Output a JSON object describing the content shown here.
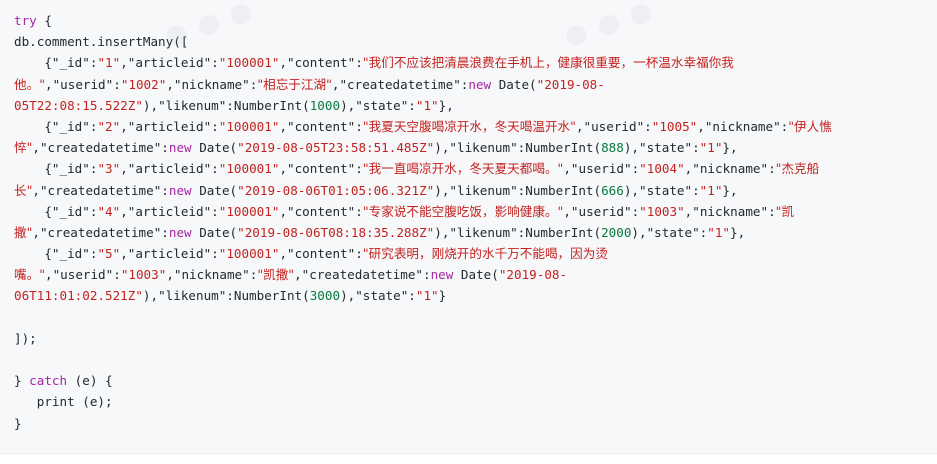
{
  "code_lines": [
    [
      {
        "t": "try",
        "c": "kw"
      },
      {
        "t": " {",
        "c": ""
      }
    ],
    [
      {
        "t": "db.comment.insertMany([",
        "c": ""
      }
    ],
    [
      {
        "t": "    {",
        "c": ""
      },
      {
        "t": "\"_id\"",
        "c": ""
      },
      {
        "t": ":",
        "c": ""
      },
      {
        "t": "\"1\"",
        "c": "str"
      },
      {
        "t": ",\"articleid\":",
        "c": ""
      },
      {
        "t": "\"100001\"",
        "c": "str"
      },
      {
        "t": ",\"content\":",
        "c": ""
      },
      {
        "t": "\"我们不应该把清晨浪费在手机上，健康很重要，一杯温水幸福你我",
        "c": "str cjk"
      }
    ],
    [
      {
        "t": "他。\"",
        "c": "str cjk"
      },
      {
        "t": ",\"userid\":",
        "c": ""
      },
      {
        "t": "\"1002\"",
        "c": "str"
      },
      {
        "t": ",\"nickname\":",
        "c": ""
      },
      {
        "t": "\"相忘于江湖\"",
        "c": "str cjk"
      },
      {
        "t": ",\"createdatetime\":",
        "c": ""
      },
      {
        "t": "new",
        "c": "kw"
      },
      {
        "t": " Date(",
        "c": ""
      },
      {
        "t": "\"2019-08-",
        "c": "str"
      }
    ],
    [
      {
        "t": "05T22:08:15.522Z\"",
        "c": "str"
      },
      {
        "t": "),\"likenum\":NumberInt(",
        "c": ""
      },
      {
        "t": "1000",
        "c": "num"
      },
      {
        "t": "),\"state\":",
        "c": ""
      },
      {
        "t": "\"1\"",
        "c": "str"
      },
      {
        "t": "},",
        "c": ""
      }
    ],
    [
      {
        "t": "    {",
        "c": ""
      },
      {
        "t": "\"_id\"",
        "c": ""
      },
      {
        "t": ":",
        "c": ""
      },
      {
        "t": "\"2\"",
        "c": "str"
      },
      {
        "t": ",\"articleid\":",
        "c": ""
      },
      {
        "t": "\"100001\"",
        "c": "str"
      },
      {
        "t": ",\"content\":",
        "c": ""
      },
      {
        "t": "\"我夏天空腹喝凉开水，冬天喝温开水\"",
        "c": "str cjk"
      },
      {
        "t": ",\"userid\":",
        "c": ""
      },
      {
        "t": "\"1005\"",
        "c": "str"
      },
      {
        "t": ",\"nickname\":",
        "c": ""
      },
      {
        "t": "\"伊人憔",
        "c": "str cjk"
      }
    ],
    [
      {
        "t": "悴\"",
        "c": "str cjk"
      },
      {
        "t": ",\"createdatetime\":",
        "c": ""
      },
      {
        "t": "new",
        "c": "kw"
      },
      {
        "t": " Date(",
        "c": ""
      },
      {
        "t": "\"2019-08-05T23:58:51.485Z\"",
        "c": "str"
      },
      {
        "t": "),\"likenum\":NumberInt(",
        "c": ""
      },
      {
        "t": "888",
        "c": "num"
      },
      {
        "t": "),\"state\":",
        "c": ""
      },
      {
        "t": "\"1\"",
        "c": "str"
      },
      {
        "t": "},",
        "c": ""
      }
    ],
    [
      {
        "t": "    {",
        "c": ""
      },
      {
        "t": "\"_id\"",
        "c": ""
      },
      {
        "t": ":",
        "c": ""
      },
      {
        "t": "\"3\"",
        "c": "str"
      },
      {
        "t": ",\"articleid\":",
        "c": ""
      },
      {
        "t": "\"100001\"",
        "c": "str"
      },
      {
        "t": ",\"content\":",
        "c": ""
      },
      {
        "t": "\"我一直喝凉开水，冬天夏天都喝。\"",
        "c": "str cjk"
      },
      {
        "t": ",\"userid\":",
        "c": ""
      },
      {
        "t": "\"1004\"",
        "c": "str"
      },
      {
        "t": ",\"nickname\":",
        "c": ""
      },
      {
        "t": "\"杰克船",
        "c": "str cjk"
      }
    ],
    [
      {
        "t": "长\"",
        "c": "str cjk"
      },
      {
        "t": ",\"createdatetime\":",
        "c": ""
      },
      {
        "t": "new",
        "c": "kw"
      },
      {
        "t": " Date(",
        "c": ""
      },
      {
        "t": "\"2019-08-06T01:05:06.321Z\"",
        "c": "str"
      },
      {
        "t": "),\"likenum\":NumberInt(",
        "c": ""
      },
      {
        "t": "666",
        "c": "num"
      },
      {
        "t": "),\"state\":",
        "c": ""
      },
      {
        "t": "\"1\"",
        "c": "str"
      },
      {
        "t": "},",
        "c": ""
      }
    ],
    [
      {
        "t": "    {",
        "c": ""
      },
      {
        "t": "\"_id\"",
        "c": ""
      },
      {
        "t": ":",
        "c": ""
      },
      {
        "t": "\"4\"",
        "c": "str"
      },
      {
        "t": ",\"articleid\":",
        "c": ""
      },
      {
        "t": "\"100001\"",
        "c": "str"
      },
      {
        "t": ",\"content\":",
        "c": ""
      },
      {
        "t": "\"专家说不能空腹吃饭，影响健康。\"",
        "c": "str cjk"
      },
      {
        "t": ",\"userid\":",
        "c": ""
      },
      {
        "t": "\"1003\"",
        "c": "str"
      },
      {
        "t": ",\"nickname\":",
        "c": ""
      },
      {
        "t": "\"凯",
        "c": "str cjk"
      }
    ],
    [
      {
        "t": "撒\"",
        "c": "str cjk"
      },
      {
        "t": ",\"createdatetime\":",
        "c": ""
      },
      {
        "t": "new",
        "c": "kw"
      },
      {
        "t": " Date(",
        "c": ""
      },
      {
        "t": "\"2019-08-06T08:18:35.288Z\"",
        "c": "str"
      },
      {
        "t": "),\"likenum\":NumberInt(",
        "c": ""
      },
      {
        "t": "2000",
        "c": "num"
      },
      {
        "t": "),\"state\":",
        "c": ""
      },
      {
        "t": "\"1\"",
        "c": "str"
      },
      {
        "t": "},",
        "c": ""
      }
    ],
    [
      {
        "t": "    {",
        "c": ""
      },
      {
        "t": "\"_id\"",
        "c": ""
      },
      {
        "t": ":",
        "c": ""
      },
      {
        "t": "\"5\"",
        "c": "str"
      },
      {
        "t": ",\"articleid\":",
        "c": ""
      },
      {
        "t": "\"100001\"",
        "c": "str"
      },
      {
        "t": ",\"content\":",
        "c": ""
      },
      {
        "t": "\"研究表明，刚烧开的水千万不能喝，因为烫",
        "c": "str cjk"
      }
    ],
    [
      {
        "t": "嘴。\"",
        "c": "str cjk"
      },
      {
        "t": ",\"userid\":",
        "c": ""
      },
      {
        "t": "\"1003\"",
        "c": "str"
      },
      {
        "t": ",\"nickname\":",
        "c": ""
      },
      {
        "t": "\"凯撒\"",
        "c": "str cjk"
      },
      {
        "t": ",\"createdatetime\":",
        "c": ""
      },
      {
        "t": "new",
        "c": "kw"
      },
      {
        "t": " Date(",
        "c": ""
      },
      {
        "t": "\"2019-08-",
        "c": "str"
      }
    ],
    [
      {
        "t": "06T11:01:02.521Z\"",
        "c": "str"
      },
      {
        "t": "),\"likenum\":NumberInt(",
        "c": ""
      },
      {
        "t": "3000",
        "c": "num"
      },
      {
        "t": "),\"state\":",
        "c": ""
      },
      {
        "t": "\"1\"",
        "c": "str"
      },
      {
        "t": "}",
        "c": ""
      }
    ],
    [],
    [
      {
        "t": "]);",
        "c": ""
      }
    ],
    [],
    [
      {
        "t": "} ",
        "c": ""
      },
      {
        "t": "catch",
        "c": "kw"
      },
      {
        "t": " (e) {",
        "c": ""
      }
    ],
    [
      {
        "t": "   print (e);",
        "c": ""
      }
    ],
    [
      {
        "t": "}",
        "c": ""
      }
    ]
  ],
  "colors": {
    "keyword": "#a626a4",
    "string": "#c5221f",
    "number": "#0b7a3e",
    "text": "#24292e",
    "background": "#f6f8fa"
  }
}
